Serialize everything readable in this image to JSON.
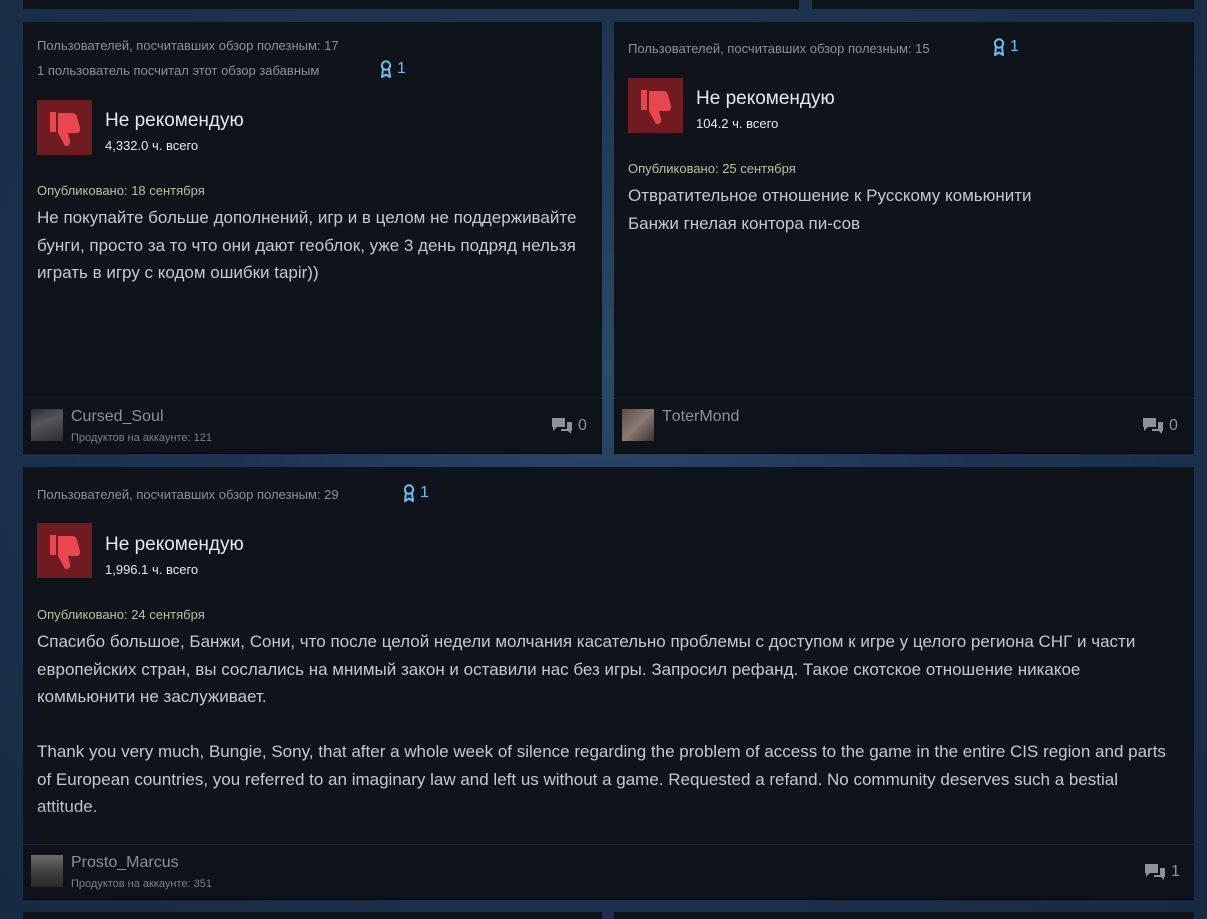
{
  "reviews": [
    {
      "helpful": "Пользователей, посчитавших обзор полезным: 17",
      "funny": "1 пользователь посчитал этот обзор забавным",
      "awards": "1",
      "recommendation": "Не рекомендую",
      "hours": "4,332.0 ч. всего",
      "posted": "Опубликовано: 18 сентября",
      "text": "Не покупайте больше дополнений, игр и в целом не поддерживайте бунги, просто за то что они дают геоблок, уже 3 день подряд нельзя играть в игру с кодом ошибки tapir))",
      "author": "Cursed_Soul",
      "products": "Продуктов на аккаунте: 121",
      "comments": "0"
    },
    {
      "helpful": "Пользователей, посчитавших обзор полезным: 15",
      "awards": "1",
      "recommendation": "Не рекомендую",
      "hours": "104.2 ч. всего",
      "posted": "Опубликовано: 25 сентября",
      "text_line1": "Отвратительное отношение к Русскому комьюнити",
      "text_line2": "Банжи гнелая контора пи-сов",
      "author": "TоterMond",
      "comments": "0"
    },
    {
      "helpful": "Пользователей, посчитавших обзор полезным: 29",
      "awards": "1",
      "recommendation": "Не рекомендую",
      "hours": "1,996.1 ч. всего",
      "posted": "Опубликовано: 24 сентября",
      "text_ru": "Спасибо большое, Банжи, Сони, что после целой недели молчания касательно проблемы с доступом к игре у целого региона СНГ и части европейских стран, вы сослались на мнимый закон и оставили нас без игры. Запросил рефанд. Такое скотское отношение никакое коммьюнити не заслуживает.",
      "text_en": "Thank you very much, Bungie, Sony, that after a whole week of silence regarding the problem of access to the game in the entire CIS region and parts of European countries, you referred to an imaginary law and left us without a game. Requested a refand. No community deserves such a bestial attitude.",
      "author": "Prosto_Marcus",
      "products": "Продуктов на аккаунте: 351",
      "comments": "1"
    }
  ],
  "colors": {
    "thumb_bg": "#701b20",
    "thumb_icon": "#e8474f",
    "award": "#66c0f4",
    "posted": "#b2c4a2"
  },
  "icons": {
    "thumb": "thumbs-down-icon",
    "award": "award-ribbon-icon",
    "comments": "comment-bubbles-icon"
  }
}
